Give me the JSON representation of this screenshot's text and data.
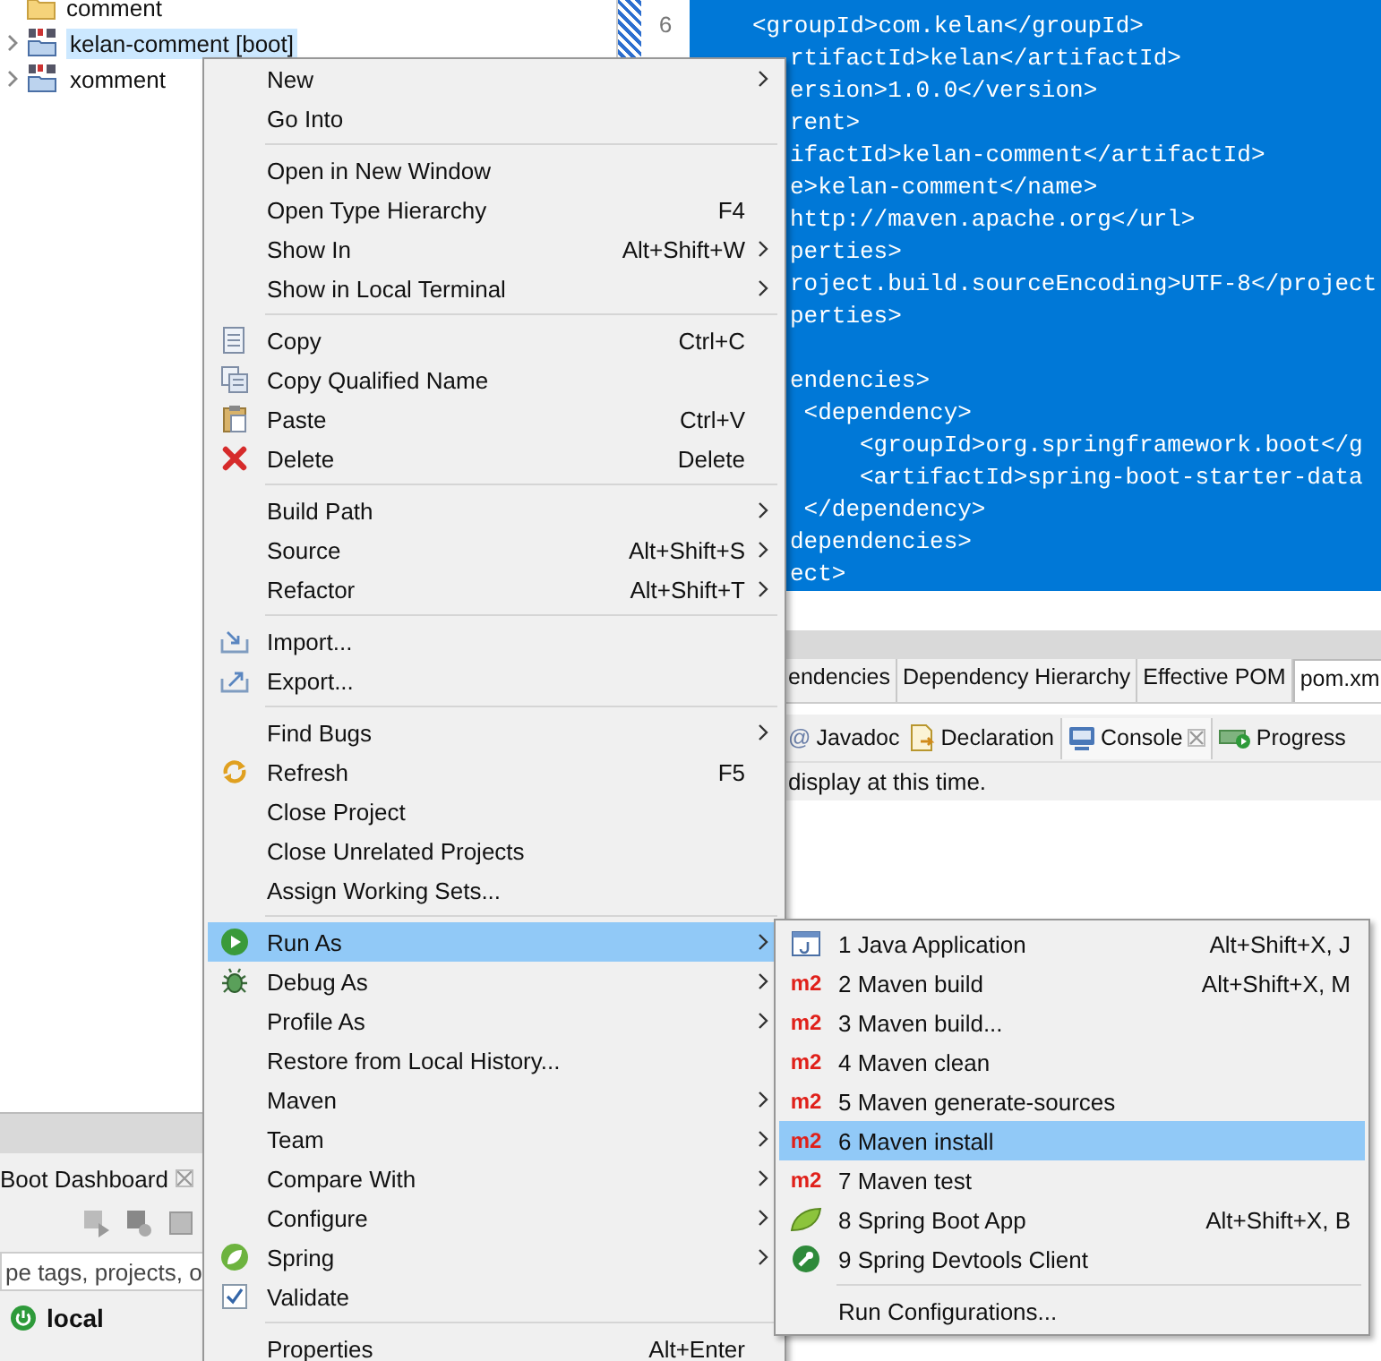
{
  "explorer": {
    "items": [
      {
        "kind": "folder",
        "label": "comment",
        "selected": false
      },
      {
        "kind": "project",
        "label": "kelan-comment [boot]",
        "selected": true,
        "expanded": false
      },
      {
        "kind": "project",
        "label": "xomment",
        "selected": false,
        "expanded": false
      }
    ]
  },
  "boot_dashboard": {
    "title": "Boot Dashboard",
    "filter": {
      "placeholder": "pe tags, projects, o"
    },
    "targets": [
      {
        "label": "local"
      }
    ]
  },
  "editor": {
    "line_numbers": [
      "6"
    ],
    "code_blocks": [
      [
        "<groupId>com.kelan</groupId>",
        "rtifactId>kelan</artifactId>",
        "ersion>1.0.0</version>",
        "rent>",
        "ifactId>kelan-comment</artifactId>",
        "e>kelan-comment</name>",
        "http://maven.apache.org</url>",
        "perties>",
        "roject.build.sourceEncoding>UTF-8</project",
        "perties>"
      ],
      [
        "endencies>",
        " <dependency>",
        "     <groupId>org.springframework.boot</g",
        "     <artifactId>spring-boot-starter-data",
        " </dependency>",
        "dependencies>",
        "ect>"
      ]
    ]
  },
  "editor_tabs": [
    {
      "label": "endencies",
      "selected": false
    },
    {
      "label": "Dependency Hierarchy",
      "selected": false
    },
    {
      "label": "Effective POM",
      "selected": false
    },
    {
      "label": "pom.xm",
      "selected": true
    }
  ],
  "views": {
    "tabs": [
      {
        "glyph": "@",
        "label": "Javadoc",
        "selected": false
      },
      {
        "label": "Declaration",
        "selected": false
      },
      {
        "label": "Console",
        "selected": true
      },
      {
        "label": "Progress",
        "selected": false
      }
    ],
    "message": "display at this time."
  },
  "context_menu": {
    "groups": [
      {
        "items": [
          {
            "label": "New",
            "submenu": true,
            "selected": false
          },
          {
            "label": "Go Into",
            "selected": false
          }
        ]
      },
      {
        "items": [
          {
            "label": "Open in New Window",
            "selected": false
          },
          {
            "label": "Open Type Hierarchy",
            "shortcut": "F4",
            "selected": false
          },
          {
            "label": "Show In",
            "shortcut": "Alt+Shift+W",
            "submenu": true,
            "selected": false
          },
          {
            "label": "Show in Local Terminal",
            "submenu": true,
            "selected": false
          }
        ]
      },
      {
        "items": [
          {
            "label": "Copy",
            "shortcut": "Ctrl+C",
            "selected": false
          },
          {
            "label": "Copy Qualified Name",
            "selected": false
          },
          {
            "label": "Paste",
            "shortcut": "Ctrl+V",
            "selected": false
          },
          {
            "label": "Delete",
            "shortcut": "Delete",
            "selected": false
          }
        ]
      },
      {
        "items": [
          {
            "label": "Build Path",
            "submenu": true,
            "selected": false
          },
          {
            "label": "Source",
            "shortcut": "Alt+Shift+S",
            "submenu": true,
            "selected": false
          },
          {
            "label": "Refactor",
            "shortcut": "Alt+Shift+T",
            "submenu": true,
            "selected": false
          }
        ]
      },
      {
        "items": [
          {
            "label": "Import...",
            "selected": false
          },
          {
            "label": "Export...",
            "selected": false
          }
        ]
      },
      {
        "items": [
          {
            "label": "Find Bugs",
            "submenu": true,
            "selected": false
          },
          {
            "label": "Refresh",
            "shortcut": "F5",
            "selected": false
          },
          {
            "label": "Close Project",
            "selected": false
          },
          {
            "label": "Close Unrelated Projects",
            "selected": false
          },
          {
            "label": "Assign Working Sets...",
            "selected": false
          }
        ]
      },
      {
        "items": [
          {
            "label": "Run As",
            "submenu": true,
            "selected": true
          },
          {
            "label": "Debug As",
            "submenu": true,
            "selected": false
          },
          {
            "label": "Profile As",
            "submenu": true,
            "selected": false
          },
          {
            "label": "Restore from Local History...",
            "selected": false
          },
          {
            "label": "Maven",
            "submenu": true,
            "selected": false
          },
          {
            "label": "Team",
            "submenu": true,
            "selected": false
          },
          {
            "label": "Compare With",
            "submenu": true,
            "selected": false
          },
          {
            "label": "Configure",
            "submenu": true,
            "selected": false
          },
          {
            "label": "Spring",
            "submenu": true,
            "selected": false
          },
          {
            "label": "Validate",
            "selected": false
          }
        ]
      },
      {
        "items": [
          {
            "label": "Properties",
            "shortcut": "Alt+Enter",
            "selected": false
          }
        ]
      }
    ]
  },
  "submenu": {
    "groups": [
      {
        "items": [
          {
            "label": "1 Java Application",
            "shortcut": "Alt+Shift+X, J",
            "selected": false
          },
          {
            "badge": "m2",
            "label": "2 Maven build",
            "shortcut": "Alt+Shift+X, M",
            "selected": false
          },
          {
            "badge": "m2",
            "label": "3 Maven build...",
            "selected": false
          },
          {
            "badge": "m2",
            "label": "4 Maven clean",
            "selected": false
          },
          {
            "badge": "m2",
            "label": "5 Maven generate-sources",
            "selected": false
          },
          {
            "badge": "m2",
            "label": "6 Maven install",
            "selected": true
          },
          {
            "badge": "m2",
            "label": "7 Maven test",
            "selected": false
          },
          {
            "label": "8 Spring Boot App",
            "shortcut": "Alt+Shift+X, B",
            "selected": false
          },
          {
            "label": "9 Spring Devtools Client",
            "selected": false
          }
        ]
      },
      {
        "items": [
          {
            "label": "Run Configurations...",
            "selected": false
          }
        ]
      }
    ]
  }
}
